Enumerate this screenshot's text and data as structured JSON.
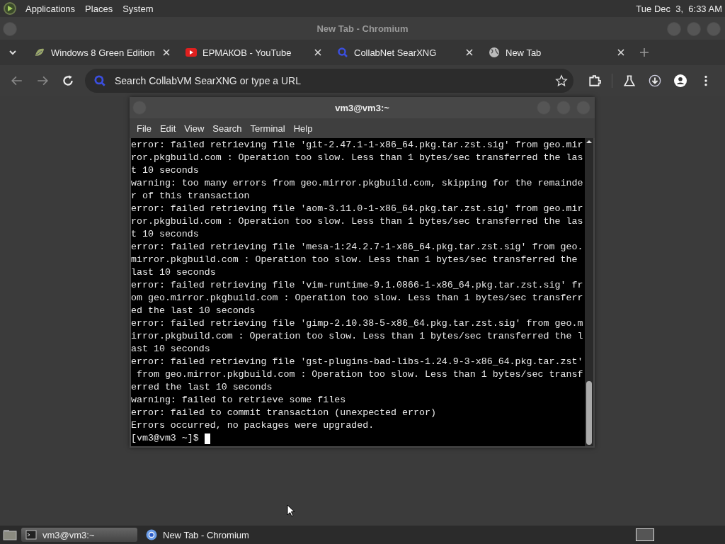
{
  "top_panel": {
    "menus": [
      "Applications",
      "Places",
      "System"
    ],
    "clock": "Tue Dec  3,  6:33 AM"
  },
  "browser": {
    "title": "New Tab - Chromium",
    "tabs": [
      {
        "label": "Windows 8 Green Edition"
      },
      {
        "label": "ЕРМАКОВ - YouTube"
      },
      {
        "label": "CollabNet SearXNG"
      },
      {
        "label": "New Tab"
      }
    ],
    "address": {
      "placeholder": "Search CollabVM SearXNG or type a URL"
    }
  },
  "terminal": {
    "title": "vm3@vm3:~",
    "menus": [
      "File",
      "Edit",
      "View",
      "Search",
      "Terminal",
      "Help"
    ],
    "lines": [
      "error: failed retrieving file 'git-2.47.1-1-x86_64.pkg.tar.zst.sig' from geo.mir",
      "ror.pkgbuild.com : Operation too slow. Less than 1 bytes/sec transferred the las",
      "t 10 seconds",
      "warning: too many errors from geo.mirror.pkgbuild.com, skipping for the remainde",
      "r of this transaction",
      "error: failed retrieving file 'aom-3.11.0-1-x86_64.pkg.tar.zst.sig' from geo.mir",
      "ror.pkgbuild.com : Operation too slow. Less than 1 bytes/sec transferred the las",
      "t 10 seconds",
      "error: failed retrieving file 'mesa-1:24.2.7-1-x86_64.pkg.tar.zst.sig' from geo.",
      "mirror.pkgbuild.com : Operation too slow. Less than 1 bytes/sec transferred the ",
      "last 10 seconds",
      "error: failed retrieving file 'vim-runtime-9.1.0866-1-x86_64.pkg.tar.zst.sig' fr",
      "om geo.mirror.pkgbuild.com : Operation too slow. Less than 1 bytes/sec transferr",
      "ed the last 10 seconds",
      "error: failed retrieving file 'gimp-2.10.38-5-x86_64.pkg.tar.zst.sig' from geo.m",
      "irror.pkgbuild.com : Operation too slow. Less than 1 bytes/sec transferred the l",
      "ast 10 seconds",
      "error: failed retrieving file 'gst-plugins-bad-libs-1.24.9-3-x86_64.pkg.tar.zst'",
      " from geo.mirror.pkgbuild.com : Operation too slow. Less than 1 bytes/sec transf",
      "erred the last 10 seconds",
      "warning: failed to retrieve some files",
      "error: failed to commit transaction (unexpected error)",
      "Errors occurred, no packages were upgraded."
    ],
    "prompt": "[vm3@vm3 ~]$ "
  },
  "taskbar": {
    "items": [
      {
        "label": "vm3@vm3:~",
        "selected": true
      },
      {
        "label": "New Tab - Chromium",
        "selected": false
      }
    ]
  }
}
